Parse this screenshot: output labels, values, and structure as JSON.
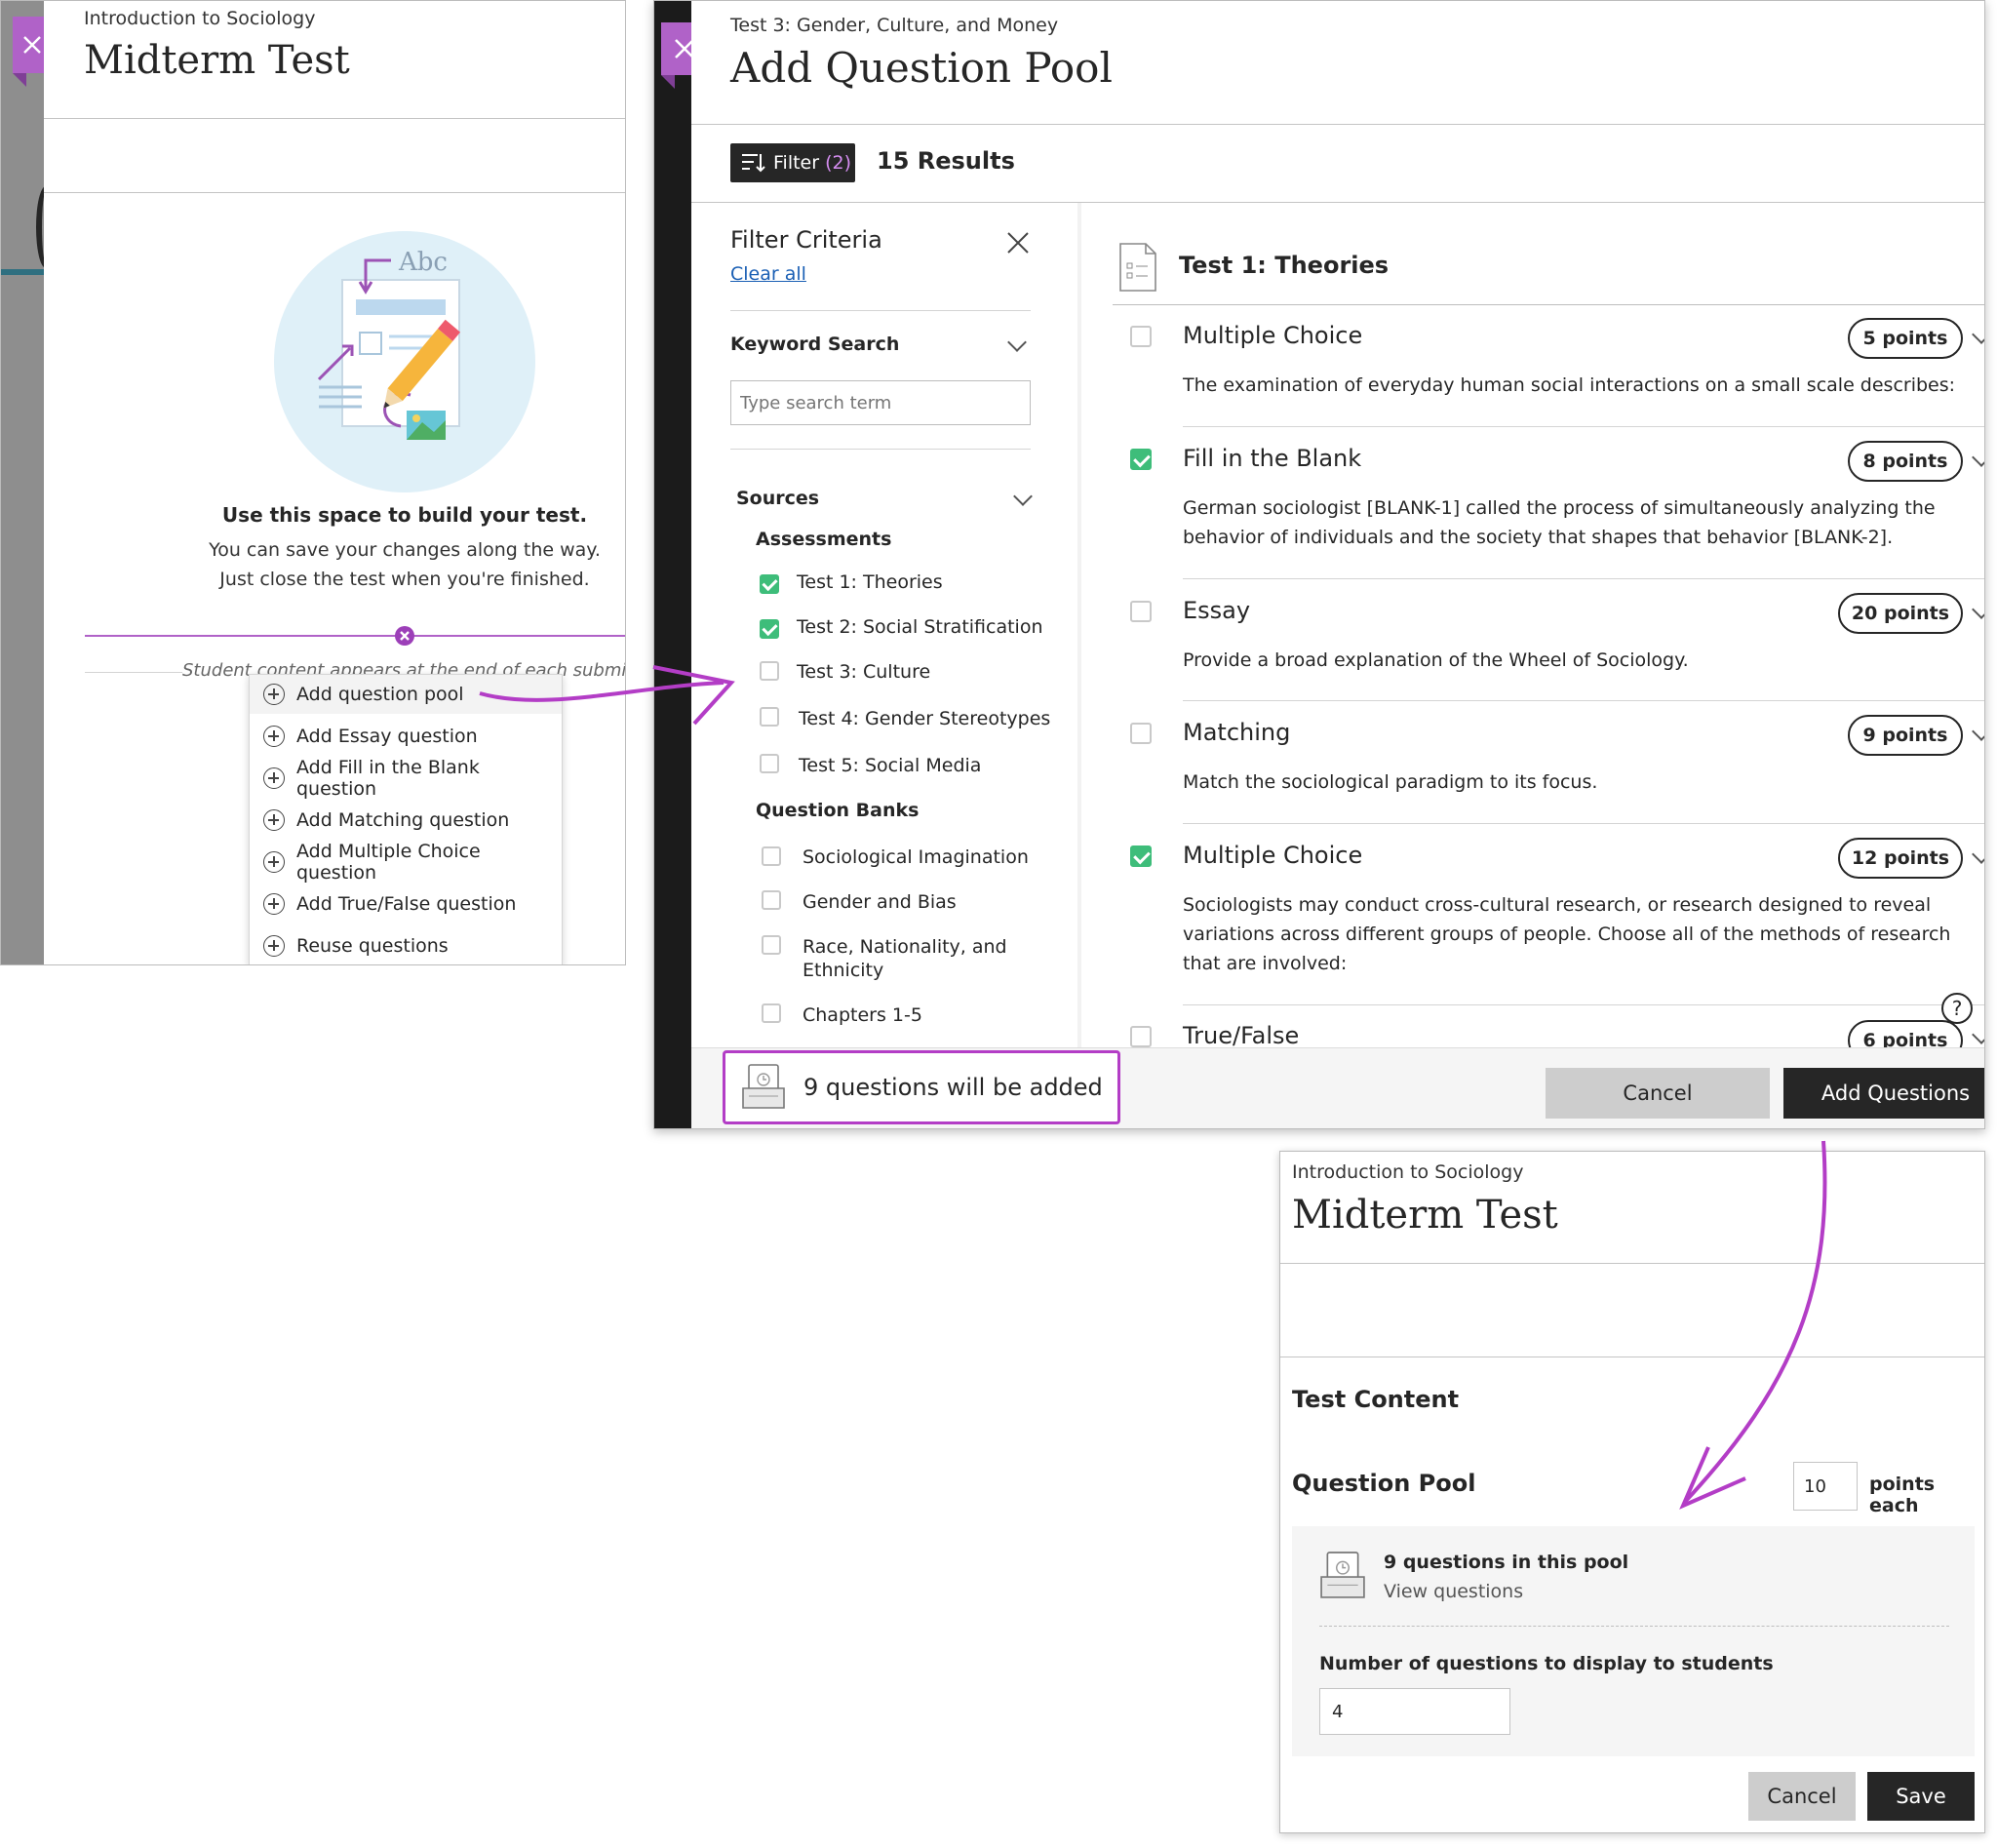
{
  "left_panel": {
    "course_name": "Introduction to Sociology",
    "title": "Midterm Test",
    "illustration_text": "Abc",
    "empty_heading": "Use this space to build your test.",
    "empty_line1": "You can save your changes along the way.",
    "empty_line2": "Just close the test when you're finished.",
    "student_note": "Student content appears at the end of each submission",
    "menu_items": [
      "Add question pool",
      "Add Essay question",
      "Add Fill in the Blank question",
      "Add Matching question",
      "Add Multiple Choice question",
      "Add True/False question",
      "Reuse questions"
    ]
  },
  "pool_panel": {
    "subtitle": "Test 3: Gender, Culture, and Money",
    "title": "Add Question Pool",
    "filter_label": "Filter",
    "filter_count": "(2)",
    "results": "15 Results",
    "filter_criteria": "Filter Criteria",
    "clear_all": "Clear all",
    "keyword_search": "Keyword Search",
    "search_placeholder": "Type search term",
    "sources": "Sources",
    "assessments_heading": "Assessments",
    "assessments": [
      {
        "label": "Test 1: Theories",
        "checked": true
      },
      {
        "label": "Test 2: Social Stratification",
        "checked": true
      },
      {
        "label": "Test 3: Culture",
        "checked": false
      },
      {
        "label": "Test 4: Gender Stereotypes",
        "checked": false
      },
      {
        "label": "Test 5: Social Media",
        "checked": false
      }
    ],
    "banks_heading": "Question Banks",
    "banks": [
      {
        "label": "Sociological Imagination",
        "checked": false
      },
      {
        "label": "Gender and Bias",
        "checked": false
      },
      {
        "label": "Race, Nationality, and",
        "label2": "Ethnicity",
        "checked": false
      },
      {
        "label": "Chapters 1-5",
        "checked": false
      }
    ],
    "group_title": "Test 1: Theories",
    "questions": [
      {
        "type": "Multiple Choice",
        "points": "5 points",
        "checked": false,
        "text": [
          "The examination of everyday human social interactions on a small scale describes:"
        ]
      },
      {
        "type": "Fill in the Blank",
        "points": "8 points",
        "checked": true,
        "text": [
          "German sociologist [BLANK-1] called the process of simultaneously analyzing the",
          "behavior of individuals and the society that shapes that behavior [BLANK-2]."
        ]
      },
      {
        "type": "Essay",
        "points": "20 points",
        "checked": false,
        "text": [
          "Provide a broad explanation of the Wheel of Sociology."
        ]
      },
      {
        "type": "Matching",
        "points": "9 points",
        "checked": false,
        "text": [
          "Match the sociological paradigm to its focus."
        ]
      },
      {
        "type": "Multiple Choice",
        "points": "12 points",
        "checked": true,
        "text": [
          "Sociologists may conduct cross-cultural research, or research designed to reveal",
          "variations across different groups of people. Choose all of the methods of research",
          "that are involved:"
        ]
      },
      {
        "type": "True/False",
        "points": "6 points",
        "checked": false,
        "text": []
      }
    ],
    "help": "?",
    "added_summary": "9 questions will be added",
    "cancel": "Cancel",
    "add_questions": "Add Questions"
  },
  "result_panel": {
    "course_name": "Introduction to Sociology",
    "title": "Midterm Test",
    "test_content": "Test Content",
    "pool_heading": "Question Pool",
    "points_value": "10",
    "points_each": "points each",
    "pool_count": "9 questions in this pool",
    "view_questions": "View questions",
    "display_label": "Number of questions to display to students",
    "display_value": "4",
    "cancel": "Cancel",
    "save": "Save"
  },
  "colors": {
    "accent": "#b062c8",
    "annotation": "#b33dc6",
    "checked": "#3ebd7a",
    "dark_button": "#262626",
    "link": "#1a5fb4"
  }
}
